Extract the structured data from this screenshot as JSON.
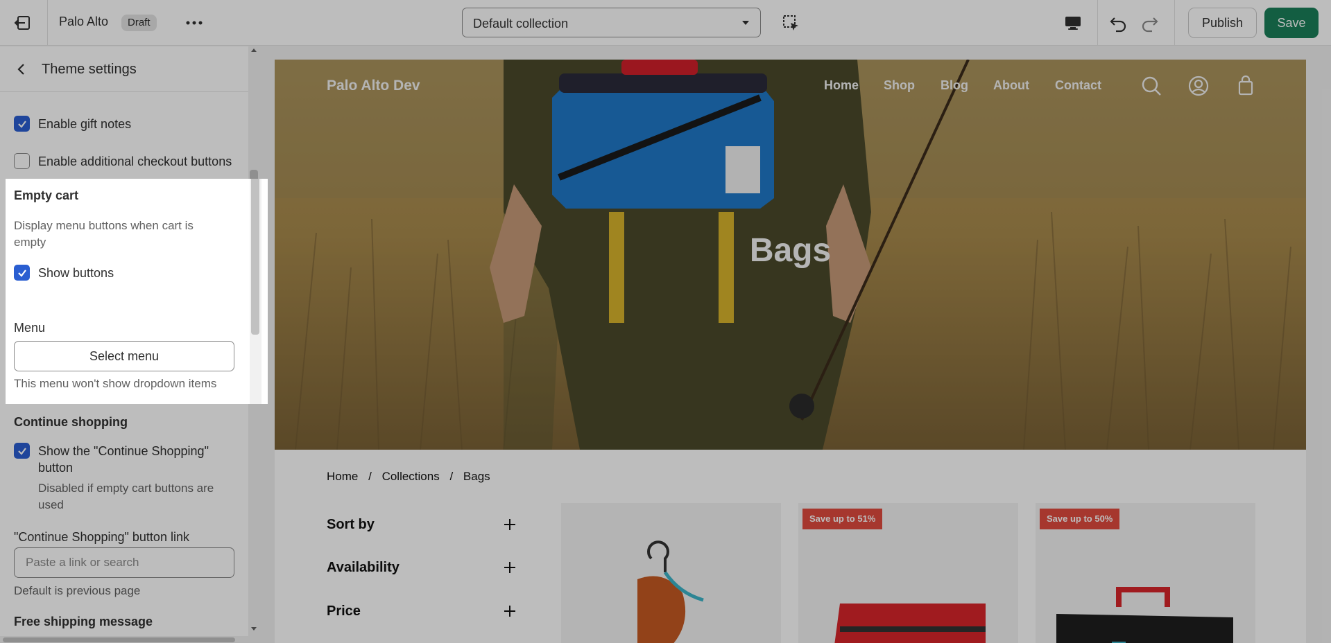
{
  "topbar": {
    "theme_name": "Palo Alto",
    "status_badge": "Draft",
    "collection_select": "Default collection",
    "publish_label": "Publish",
    "save_label": "Save"
  },
  "sidebar": {
    "title": "Theme settings",
    "items": {
      "gift_notes": "Enable gift notes",
      "additional_checkout": "Enable additional checkout buttons",
      "empty_cart_heading": "Empty cart",
      "empty_cart_help": "Display menu buttons when cart is empty",
      "show_buttons": "Show buttons",
      "menu_label": "Menu",
      "select_menu": "Select menu",
      "menu_help": "This menu won't show dropdown items",
      "continue_heading": "Continue shopping",
      "show_continue": "Show the \"Continue Shopping\" button",
      "continue_help": "Disabled if empty cart buttons are used",
      "continue_link_label": "\"Continue Shopping\" button link",
      "continue_link_placeholder": "Paste a link or search",
      "continue_link_help": "Default is previous page",
      "free_shipping_heading": "Free shipping message"
    },
    "checkbox_states": {
      "gift_notes": true,
      "additional_checkout": false,
      "show_buttons": true,
      "show_continue": true
    }
  },
  "preview": {
    "store_name": "Palo Alto Dev",
    "nav": [
      "Home",
      "Shop",
      "Blog",
      "About",
      "Contact"
    ],
    "hero_title": "Bags",
    "breadcrumb": [
      "Home",
      "/",
      "Collections",
      "/",
      "Bags"
    ],
    "filters": [
      "Sort by",
      "Availability",
      "Price"
    ],
    "badges": [
      "Save up to 51%",
      "Save up to 50%"
    ]
  },
  "colors": {
    "save_button": "#1a7f5a",
    "checkbox_checked": "#2a5ed1",
    "sale_badge": "#e04b3f"
  },
  "icons": [
    "exit-icon",
    "more-horizontal-icon",
    "chevron-down-icon",
    "inspect-icon",
    "desktop-icon",
    "undo-icon",
    "redo-icon",
    "back-arrow-icon",
    "checkmark-icon",
    "search-icon",
    "account-icon",
    "cart-icon",
    "plus-icon"
  ]
}
